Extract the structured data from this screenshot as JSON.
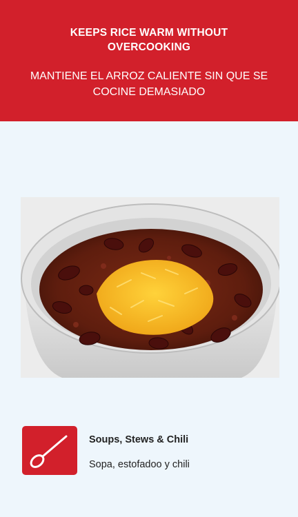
{
  "banner": {
    "title": "KEEPS RICE WARM WITHOUT OVERCOOKING",
    "subtitle": "MANTIENE EL ARROZ CALIENTE SIN QUE SE COCINE DEMASIADO"
  },
  "photo": {
    "subject": "chili-bowl-photo"
  },
  "feature": {
    "icon": "spoon-icon",
    "title": "Soups, Stews & Chili",
    "subtitle": "Sopa, estofadoo y chili"
  },
  "colors": {
    "brand_red": "#d2202b",
    "page_background": "#eef6fc",
    "text_dark": "#222222"
  }
}
